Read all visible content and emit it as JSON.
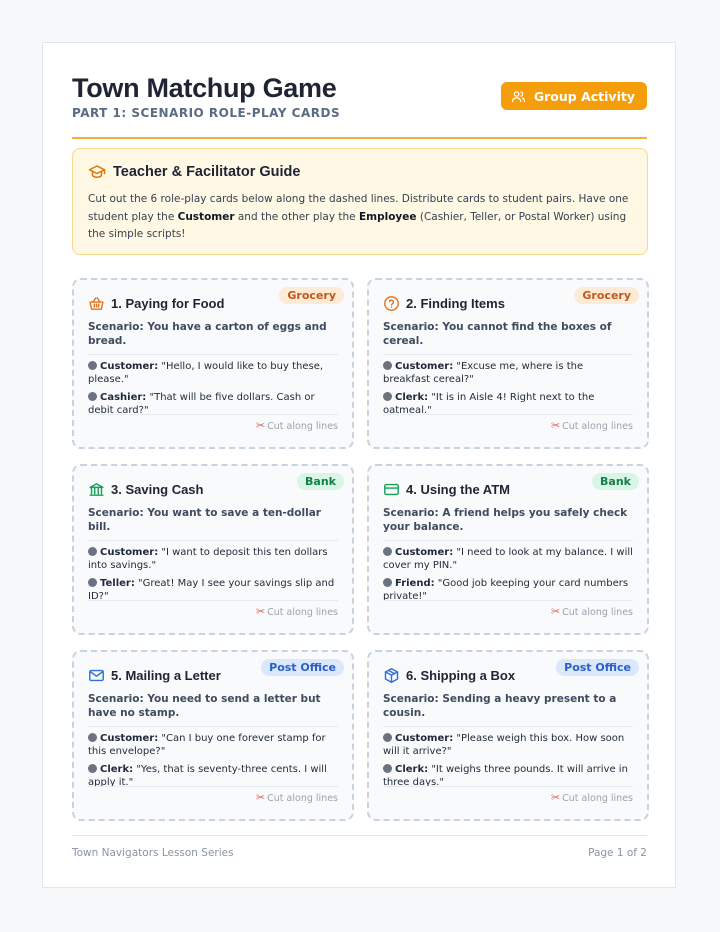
{
  "header": {
    "title": "Town Matchup Game",
    "subtitle": "PART 1: SCENARIO ROLE-PLAY CARDS",
    "badge": "Group Activity"
  },
  "guide": {
    "title": "Teacher & Facilitator Guide",
    "text1": "Cut out the 6 role-play cards below along the dashed lines. Distribute cards to student pairs. Have one student play the ",
    "bold1": "Customer",
    "text2": " and the other play the ",
    "bold2": "Employee",
    "text3": " (Cashier, Teller, or Postal Worker) using the simple scripts!"
  },
  "cut_label": "Cut along lines",
  "cards": [
    {
      "title": "1. Paying for Food",
      "tag": "Grocery",
      "scenario": "Scenario: You have a carton of eggs and bread.",
      "lines": [
        {
          "speaker": "Customer:",
          "text": " \"Hello, I would like to buy these, please.\""
        },
        {
          "speaker": "Cashier:",
          "text": " \"That will be five dollars. Cash or debit card?\""
        }
      ]
    },
    {
      "title": "2. Finding Items",
      "tag": "Grocery",
      "scenario": "Scenario: You cannot find the boxes of cereal.",
      "lines": [
        {
          "speaker": "Customer:",
          "text": " \"Excuse me, where is the breakfast cereal?\""
        },
        {
          "speaker": "Clerk:",
          "text": " \"It is in Aisle 4! Right next to the oatmeal.\""
        }
      ]
    },
    {
      "title": "3. Saving Cash",
      "tag": "Bank",
      "scenario": "Scenario: You want to save a ten-dollar bill.",
      "lines": [
        {
          "speaker": "Customer:",
          "text": " \"I want to deposit this ten dollars into savings.\""
        },
        {
          "speaker": "Teller:",
          "text": " \"Great! May I see your savings slip and ID?\""
        }
      ]
    },
    {
      "title": "4. Using the ATM",
      "tag": "Bank",
      "scenario": "Scenario: A friend helps you safely check your balance.",
      "lines": [
        {
          "speaker": "Customer:",
          "text": " \"I need to look at my balance. I will cover my PIN.\""
        },
        {
          "speaker": "Friend:",
          "text": " \"Good job keeping your card numbers private!\""
        }
      ]
    },
    {
      "title": "5. Mailing a Letter",
      "tag": "Post Office",
      "scenario": "Scenario: You need to send a letter but have no stamp.",
      "lines": [
        {
          "speaker": "Customer:",
          "text": " \"Can I buy one forever stamp for this envelope?\""
        },
        {
          "speaker": "Clerk:",
          "text": " \"Yes, that is seventy-three cents. I will apply it.\""
        }
      ]
    },
    {
      "title": "6. Shipping a Box",
      "tag": "Post Office",
      "scenario": "Scenario: Sending a heavy present to a cousin.",
      "lines": [
        {
          "speaker": "Customer:",
          "text": " \"Please weigh this box. How soon will it arrive?\""
        },
        {
          "speaker": "Clerk:",
          "text": " \"It weighs three pounds. It will arrive in three days.\""
        }
      ]
    }
  ],
  "footer": {
    "left": "Town Navigators Lesson Series",
    "right": "Page 1 of 2"
  },
  "colors": {
    "accent": "#f59e0b",
    "grocery": "#c2571a",
    "bank": "#14804a",
    "post_office": "#2a5fc8"
  }
}
